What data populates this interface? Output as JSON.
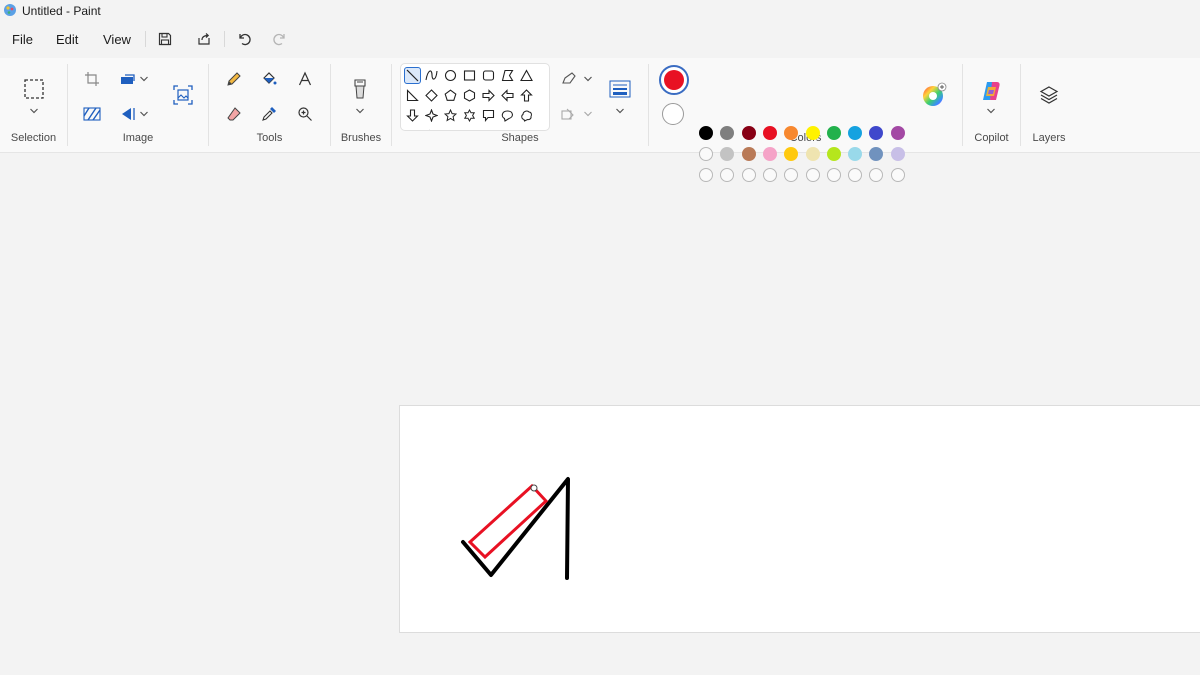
{
  "window": {
    "title": "Untitled - Paint"
  },
  "menu": {
    "file": "File",
    "edit": "Edit",
    "view": "View"
  },
  "quick_access": [
    "save-icon",
    "share-icon",
    "undo-icon",
    "redo-icon"
  ],
  "ribbon": {
    "groups": {
      "selection": "Selection",
      "image": "Image",
      "tools": "Tools",
      "brushes": "Brushes",
      "shapes": "Shapes",
      "colors": "Colors",
      "copilot": "Copilot",
      "layers": "Layers"
    }
  },
  "colors": {
    "primary": "#e81123",
    "secondary": "#ffffff",
    "palette_row1": [
      "#000000",
      "#7f7f7f",
      "#880015",
      "#e81123",
      "#f7882f",
      "#fff200",
      "#22b14c",
      "#15a2e0",
      "#3f48cc",
      "#a349a4"
    ],
    "palette_row2": [
      "#ffffff",
      "#c3c3c3",
      "#b97a57",
      "#f5a3c7",
      "#ffc90e",
      "#efe4b0",
      "#b5e61d",
      "#99d9ea",
      "#7092be",
      "#c8bfe7"
    ],
    "palette_row3_custom_slots": 10
  },
  "drawing": {
    "stroke_colors": [
      "#000000",
      "#e81123"
    ]
  }
}
